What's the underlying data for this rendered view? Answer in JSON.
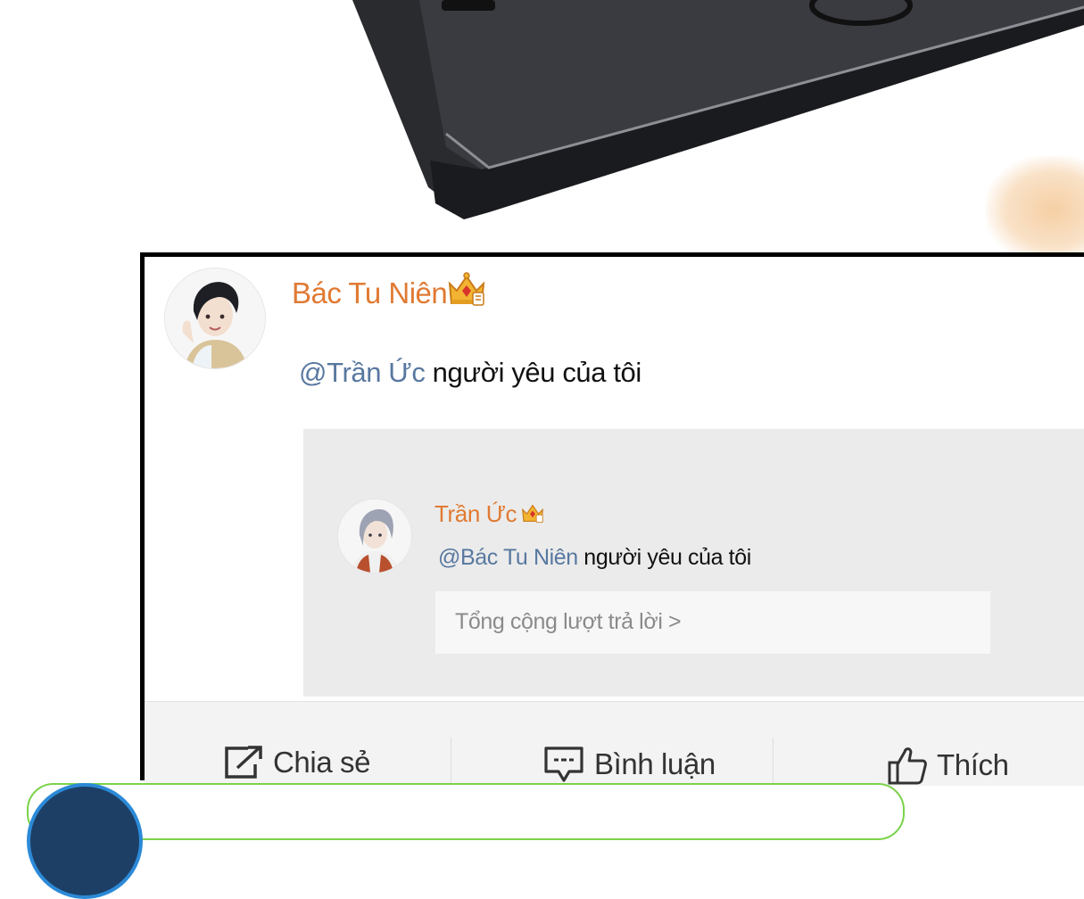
{
  "post": {
    "author": "Bác Tu Niên",
    "mention": "@Trần Ức",
    "text": " người yêu của tôi",
    "badge_icon": "crown-icon"
  },
  "quoted": {
    "author": "Trần Ức",
    "mention": "@Bác Tu Niên",
    "text": " người yêu của tôi",
    "replies_link": "Tổng cộng lượt trả lời >",
    "badge_icon": "crown-icon"
  },
  "actions": [
    {
      "label": "Chia sẻ",
      "icon": "share-icon"
    },
    {
      "label": "Bình luận",
      "icon": "comment-icon"
    },
    {
      "label": "Thích",
      "icon": "thumbs-up-icon"
    }
  ],
  "colors": {
    "author": "#e07a33",
    "mention": "#5878a0",
    "card_border": "#000000",
    "quote_bg": "#ebebeb",
    "next_bubble_border": "#7bd24a"
  }
}
